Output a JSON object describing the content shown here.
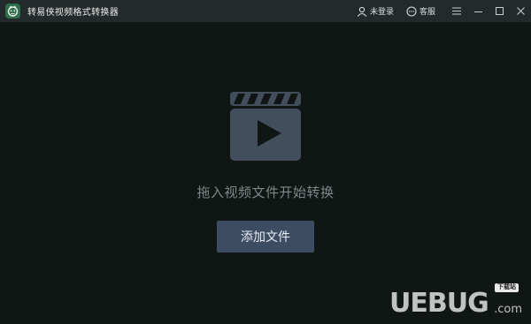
{
  "app": {
    "title": "转易侠视频格式转换器",
    "logo_icon": "app-logo-icon"
  },
  "header": {
    "login_label": "未登录",
    "service_label": "客服",
    "menu_icon": "hamburger-icon",
    "minimize_icon": "minimize-icon",
    "maximize_icon": "maximize-icon",
    "close_icon": "close-icon"
  },
  "main": {
    "drop_hint": "拖入视频文件开始转换",
    "add_button_label": "添加文件",
    "center_icon": "video-clapper-icon"
  },
  "watermark": {
    "main_text": "UEBUG",
    "domain_text": ".com",
    "badge_text": "下载站"
  },
  "colors": {
    "background": "#0f1614",
    "titlebar": "#242a2b",
    "icon_fill": "#434e5c",
    "button": "#3b4c63"
  }
}
